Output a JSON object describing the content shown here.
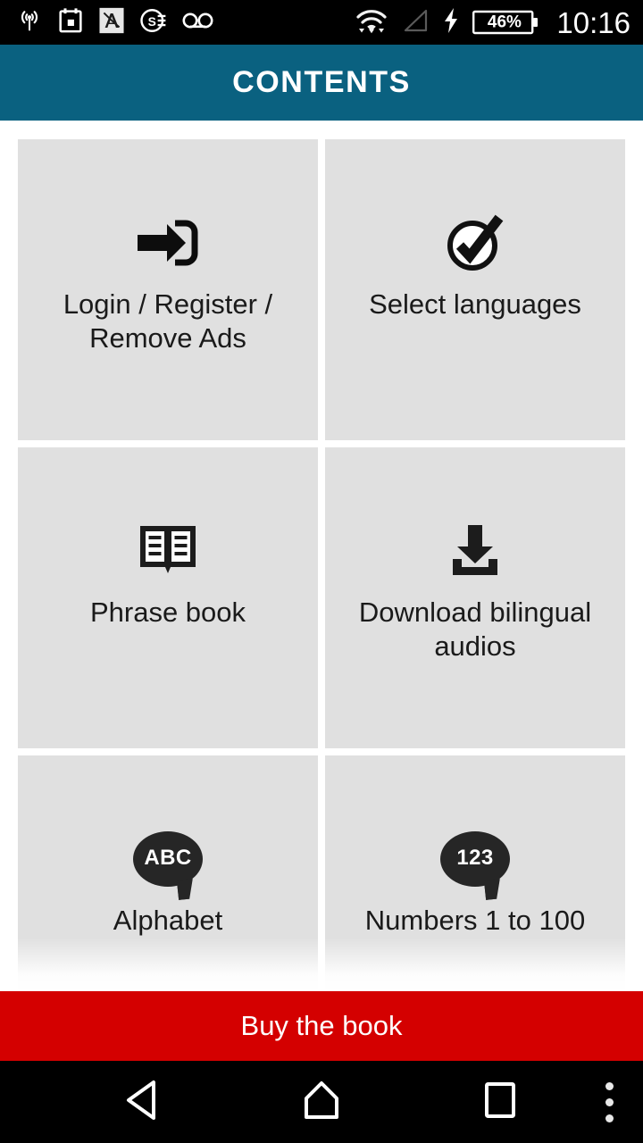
{
  "status_bar": {
    "left_icons": [
      {
        "name": "broadcast-signal-icon",
        "glyph": "broadcast"
      },
      {
        "name": "calendar-icon",
        "glyph": "calendar"
      },
      {
        "name": "avira-antivirus-icon",
        "glyph": "avira"
      },
      {
        "name": "se-app-icon",
        "glyph": "se-circle"
      },
      {
        "name": "voicemail-icon",
        "glyph": "voicemail"
      }
    ],
    "right_icons": [
      {
        "name": "wifi-icon",
        "glyph": "wifi"
      },
      {
        "name": "cellular-signal-icon",
        "glyph": "signal-triangle"
      },
      {
        "name": "charging-bolt-icon",
        "glyph": "bolt"
      }
    ],
    "battery_percent": "46%",
    "clock": "10:16"
  },
  "header": {
    "title": "CONTENTS",
    "background_color": "#0a6180"
  },
  "grid": {
    "items": [
      {
        "icon": "login-arrow-icon",
        "label": "Login / Register / Remove Ads"
      },
      {
        "icon": "check-circle-icon",
        "label": "Select languages"
      },
      {
        "icon": "open-book-icon",
        "label": "Phrase book"
      },
      {
        "icon": "download-icon",
        "label": "Download bilingual audios"
      },
      {
        "icon": "speech-bubble-abc-icon",
        "label": "Alphabet",
        "bubble_text": "ABC"
      },
      {
        "icon": "speech-bubble-123-icon",
        "label": "Numbers 1 to 100",
        "bubble_text": "123"
      }
    ],
    "card_color": "#e0e0e0"
  },
  "buy_banner": {
    "label": "Buy the book",
    "background_color": "#d40000"
  },
  "nav_bar": {
    "back": "back-button",
    "home": "home-button",
    "recents": "recents-button",
    "overflow": "overflow-menu-button"
  }
}
